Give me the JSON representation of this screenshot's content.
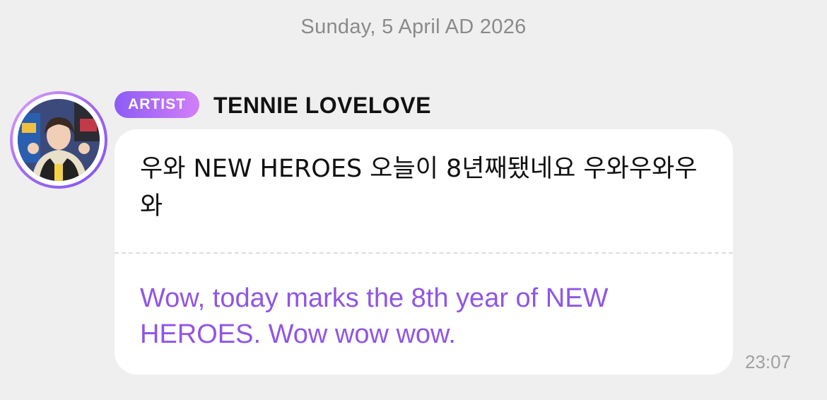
{
  "date_header": "Sunday, 5 April AD 2026",
  "message": {
    "badge": "ARTIST",
    "sender": "TENNIE LOVELOVE",
    "original_text": "우와 NEW HEROES 오늘이 8년째됐네요 우와우와우와",
    "translated_text": "Wow, today marks the 8th year of NEW HEROES. Wow wow wow.",
    "time": "23:07"
  },
  "colors": {
    "background": "#efefef",
    "bubble": "#ffffff",
    "badge_gradient": [
      "#8c5cf5",
      "#d27ef9"
    ],
    "translation_text": "#8f56e6",
    "timestamp": "#a0a0a0"
  },
  "icons": {
    "avatar": "artist-profile-photo"
  }
}
